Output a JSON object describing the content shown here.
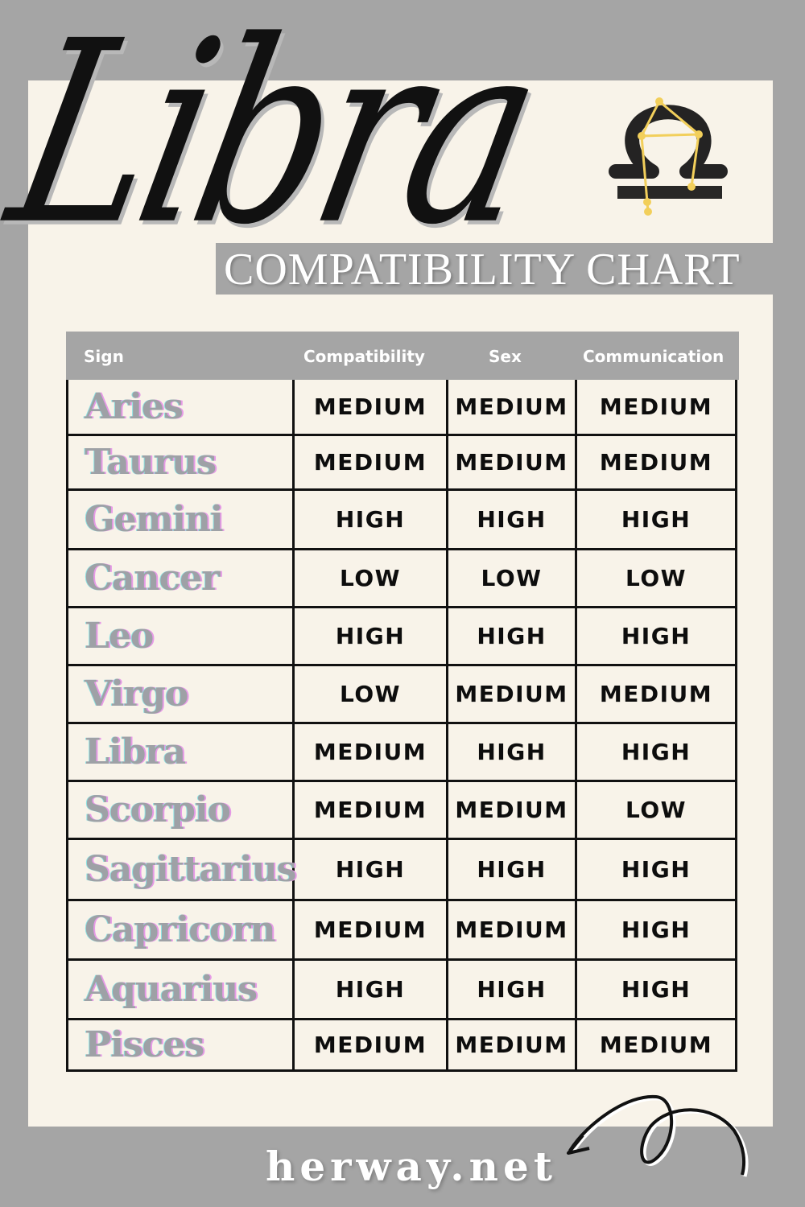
{
  "title": {
    "main": "Libra",
    "subtitle": "COMPATIBILITY CHART"
  },
  "icons": {
    "zodiac": "libra-symbol-icon",
    "decoration": "curly-arrow-icon"
  },
  "colors": {
    "background": "#a5a5a5",
    "panel": "#f8f3e9",
    "constellation": "#f2cf5b",
    "sign_text": "#9ea1a6"
  },
  "table": {
    "headers": [
      "Sign",
      "Compatibility",
      "Sex",
      "Communication"
    ],
    "rows": [
      {
        "sign": "Aries",
        "compatibility": "MEDIUM",
        "sex": "MEDIUM",
        "communication": "MEDIUM"
      },
      {
        "sign": "Taurus",
        "compatibility": "MEDIUM",
        "sex": "MEDIUM",
        "communication": "MEDIUM"
      },
      {
        "sign": "Gemini",
        "compatibility": "HIGH",
        "sex": "HIGH",
        "communication": "HIGH"
      },
      {
        "sign": "Cancer",
        "compatibility": "LOW",
        "sex": "LOW",
        "communication": "LOW"
      },
      {
        "sign": "Leo",
        "compatibility": "HIGH",
        "sex": "HIGH",
        "communication": "HIGH"
      },
      {
        "sign": "Virgo",
        "compatibility": "LOW",
        "sex": "MEDIUM",
        "communication": "MEDIUM"
      },
      {
        "sign": "Libra",
        "compatibility": "MEDIUM",
        "sex": "HIGH",
        "communication": "HIGH"
      },
      {
        "sign": "Scorpio",
        "compatibility": "MEDIUM",
        "sex": "MEDIUM",
        "communication": "LOW"
      },
      {
        "sign": "Sagittarius",
        "compatibility": "HIGH",
        "sex": "HIGH",
        "communication": "HIGH"
      },
      {
        "sign": "Capricorn",
        "compatibility": "MEDIUM",
        "sex": "MEDIUM",
        "communication": "HIGH"
      },
      {
        "sign": "Aquarius",
        "compatibility": "HIGH",
        "sex": "HIGH",
        "communication": "HIGH"
      },
      {
        "sign": "Pisces",
        "compatibility": "MEDIUM",
        "sex": "MEDIUM",
        "communication": "MEDIUM"
      }
    ]
  },
  "footer": {
    "site": "herway.net"
  }
}
